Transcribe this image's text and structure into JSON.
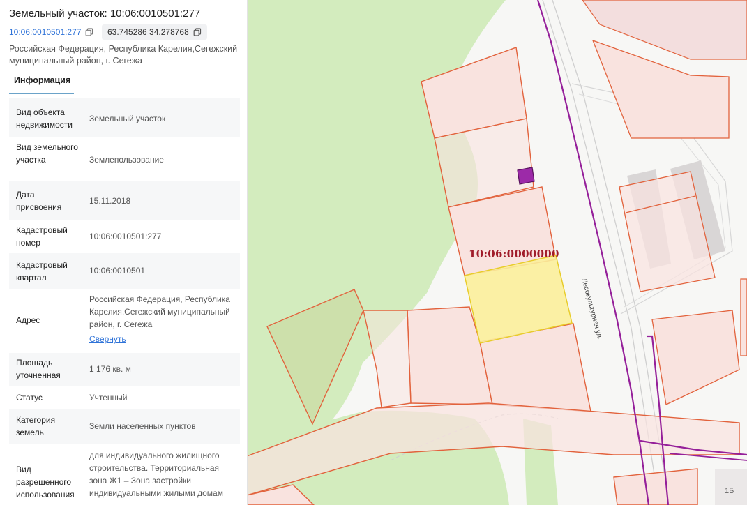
{
  "header": {
    "title": "Земельный участок: 10:06:0010501:277",
    "cadastral_link": "10:06:0010501:277",
    "coordinates": "63.745286 34.278768",
    "address": "Российская Федерация, Республика Карелия,Сегежский муниципальный район, г. Сегежа"
  },
  "tabs": {
    "info": "Информация"
  },
  "rows": [
    {
      "label": "Вид объекта недвижимости",
      "value": "Земельный участок"
    },
    {
      "label": "Вид земельного участка",
      "value": "Землепользование"
    },
    {
      "label": "Дата присвоения",
      "value": "15.11.2018"
    },
    {
      "label": "Кадастровый номер",
      "value": "10:06:0010501:277"
    },
    {
      "label": "Кадастровый квартал",
      "value": "10:06:0010501"
    },
    {
      "label": "Адрес",
      "value": "Российская Федерация, Республика Карелия,Сегежский муниципальный район, г. Сегежа",
      "action": "Свернуть"
    },
    {
      "label": "Площадь уточненная",
      "value": "1 176 кв. м"
    },
    {
      "label": "Статус",
      "value": "Учтенный"
    },
    {
      "label": "Категория земель",
      "value": "Земли населенных пунктов"
    },
    {
      "label": "Вид разрешенного использования",
      "value": "для индивидуального жилищного строительства. Территориальная зона Ж1 – Зона застройки индивидуальными жилыми домам"
    }
  ],
  "map": {
    "parcel_label": "10:06:0000000",
    "street_label": "Лесокультурная ул.",
    "building_label": "1Б",
    "colors": {
      "forest": "#d3ecbe",
      "parcel_fill": "#f9e3df",
      "parcel_stroke": "#e2623c",
      "selected_fill": "#fbee9b",
      "selected_stroke": "#e8cc2b",
      "power_line": "#95209a",
      "road": "#c7c7c7"
    }
  },
  "icons": [
    "copy-icon",
    "power-marker-icon"
  ]
}
